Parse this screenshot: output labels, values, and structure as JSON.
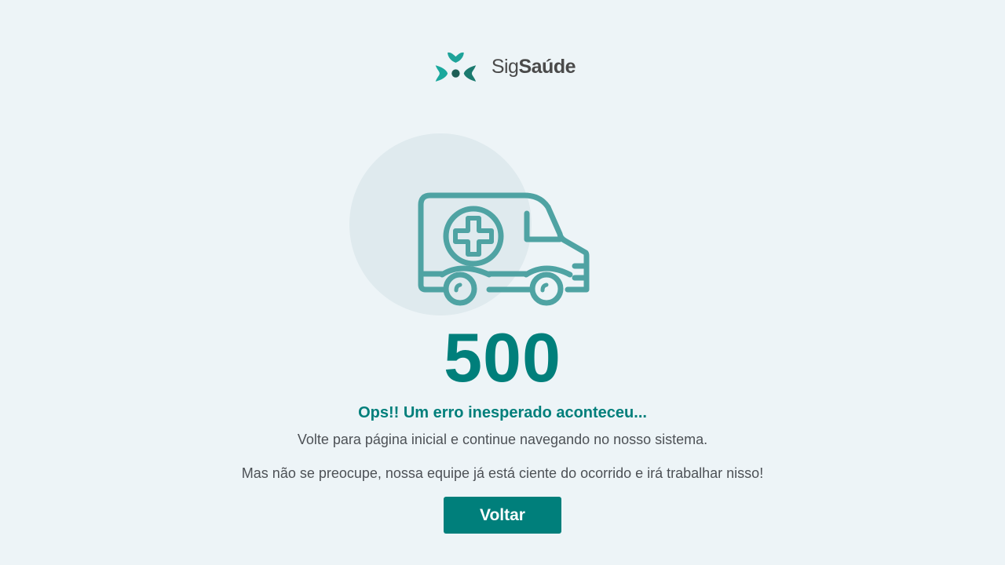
{
  "brand": {
    "name_light": "Sig",
    "name_bold": "Saúde",
    "logo_icon": "sigsaude-logo-icon"
  },
  "illustration": {
    "icon": "ambulance-icon"
  },
  "error": {
    "code": "500",
    "headline": "Ops!! Um erro inesperado aconteceu...",
    "message_line1": "Volte para página inicial e continue navegando no nosso sistema.",
    "message_line2": "Mas não se preocupe, nossa equipe já está ciente do ocorrido e irá trabalhar nisso!"
  },
  "actions": {
    "back_label": "Voltar"
  },
  "colors": {
    "background": "#edf4f7",
    "accent": "#007f7b",
    "icon_stroke": "#4fa3a3",
    "circle": "#dfeaee",
    "text": "#4d5156"
  }
}
